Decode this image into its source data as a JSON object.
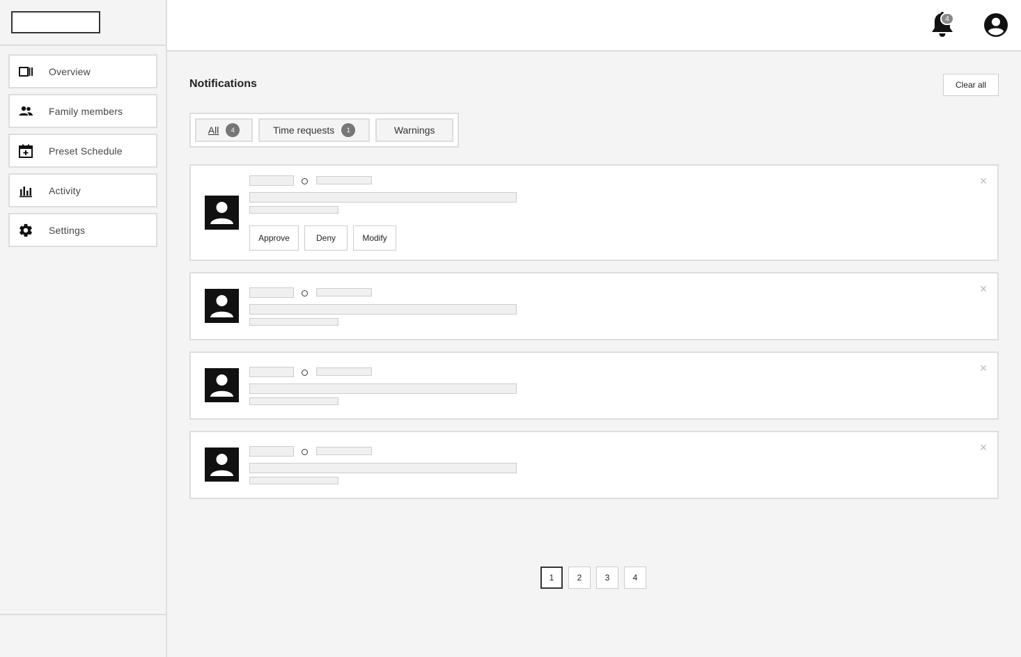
{
  "sidebar": {
    "items": [
      {
        "label": "Overview",
        "icon": "overview-icon"
      },
      {
        "label": "Family members",
        "icon": "people-icon"
      },
      {
        "label": "Preset Schedule",
        "icon": "calendar-add-icon"
      },
      {
        "label": "Activity",
        "icon": "bar-chart-icon"
      },
      {
        "label": "Settings",
        "icon": "gear-icon"
      }
    ]
  },
  "header": {
    "notification_count": "4"
  },
  "main": {
    "title": "Notifications",
    "clear_all": "Clear all",
    "tabs": [
      {
        "label": "All",
        "count": "4"
      },
      {
        "label": "Time requests",
        "count": "1"
      },
      {
        "label": "Warnings",
        "count": ""
      }
    ],
    "actions": {
      "approve": "Approve",
      "deny": "Deny",
      "modify": "Modify"
    },
    "close_symbol": "×"
  },
  "pagination": {
    "pages": [
      "1",
      "2",
      "3",
      "4"
    ],
    "active": "1"
  }
}
